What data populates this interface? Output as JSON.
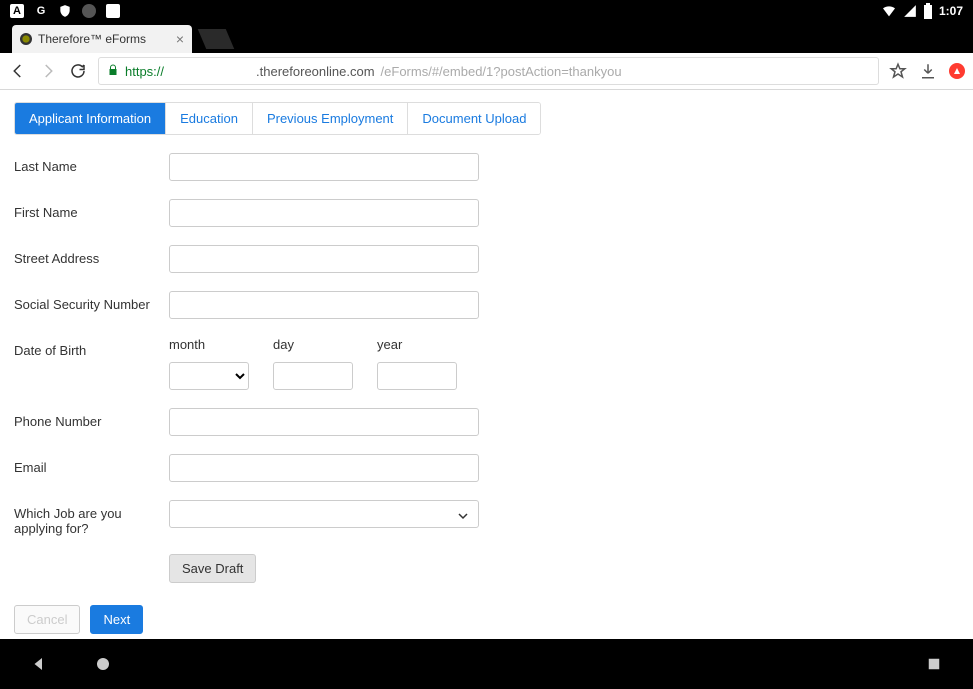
{
  "status_bar": {
    "clock": "1:07",
    "icons_left": [
      "A",
      "G",
      "shield",
      "dot",
      "note"
    ]
  },
  "browser": {
    "tab_title": "Therefore™ eForms",
    "url_scheme": "https://",
    "url_host": ".thereforeonline.com",
    "url_path": "/eForms/#/embed/1?postAction=thankyou"
  },
  "tabs": [
    {
      "label": "Applicant Information",
      "active": true
    },
    {
      "label": "Education",
      "active": false
    },
    {
      "label": "Previous Employment",
      "active": false
    },
    {
      "label": "Document Upload",
      "active": false
    }
  ],
  "form": {
    "last_name": {
      "label": "Last Name",
      "value": ""
    },
    "first_name": {
      "label": "First Name",
      "value": ""
    },
    "street_address": {
      "label": "Street Address",
      "value": ""
    },
    "ssn": {
      "label": "Social Security Number",
      "value": ""
    },
    "dob": {
      "label": "Date of Birth",
      "month_label": "month",
      "day_label": "day",
      "year_label": "year",
      "month": "",
      "day": "",
      "year": ""
    },
    "phone": {
      "label": "Phone Number",
      "value": ""
    },
    "email": {
      "label": "Email",
      "value": ""
    },
    "job": {
      "label": "Which Job are you applying for?",
      "value": ""
    }
  },
  "buttons": {
    "save_draft": "Save Draft",
    "cancel": "Cancel",
    "next": "Next"
  }
}
